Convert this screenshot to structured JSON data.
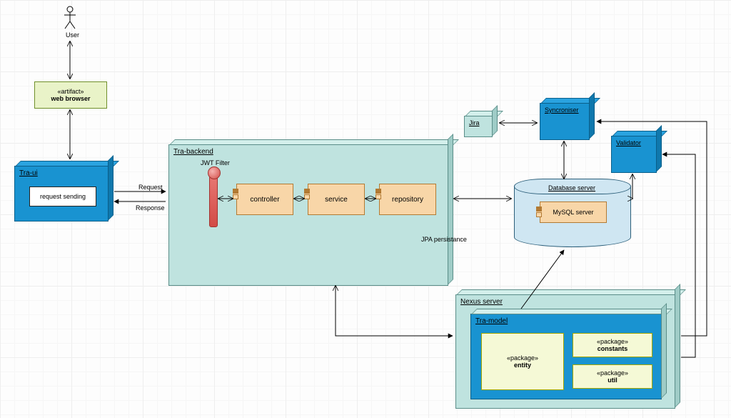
{
  "actor": {
    "label": "User"
  },
  "artifact": {
    "stereotype": "«artifact»",
    "name": "web browser"
  },
  "tra_ui": {
    "title": "Tra-ui",
    "request_sending": "request sending"
  },
  "tra_backend": {
    "title": "Tra-backend",
    "jwt_filter": "JWT Filter",
    "controller": "controller",
    "service": "service",
    "repository": "repository"
  },
  "edges": {
    "request": "Request",
    "response": "Response",
    "jpa": "JPA persistance"
  },
  "jira": {
    "title": "Jira"
  },
  "syncroniser": {
    "title": "Syncroniser"
  },
  "validator": {
    "title": "Validator"
  },
  "database": {
    "title": "Database server",
    "mysql": "MySQL server"
  },
  "nexus": {
    "title": "Nexus server"
  },
  "tra_model": {
    "title": "Tra-model",
    "entity": {
      "stereotype": "«package»",
      "name": "entity"
    },
    "constants": {
      "stereotype": "«package»",
      "name": "constants"
    },
    "util": {
      "stereotype": "«package»",
      "name": "util"
    }
  }
}
